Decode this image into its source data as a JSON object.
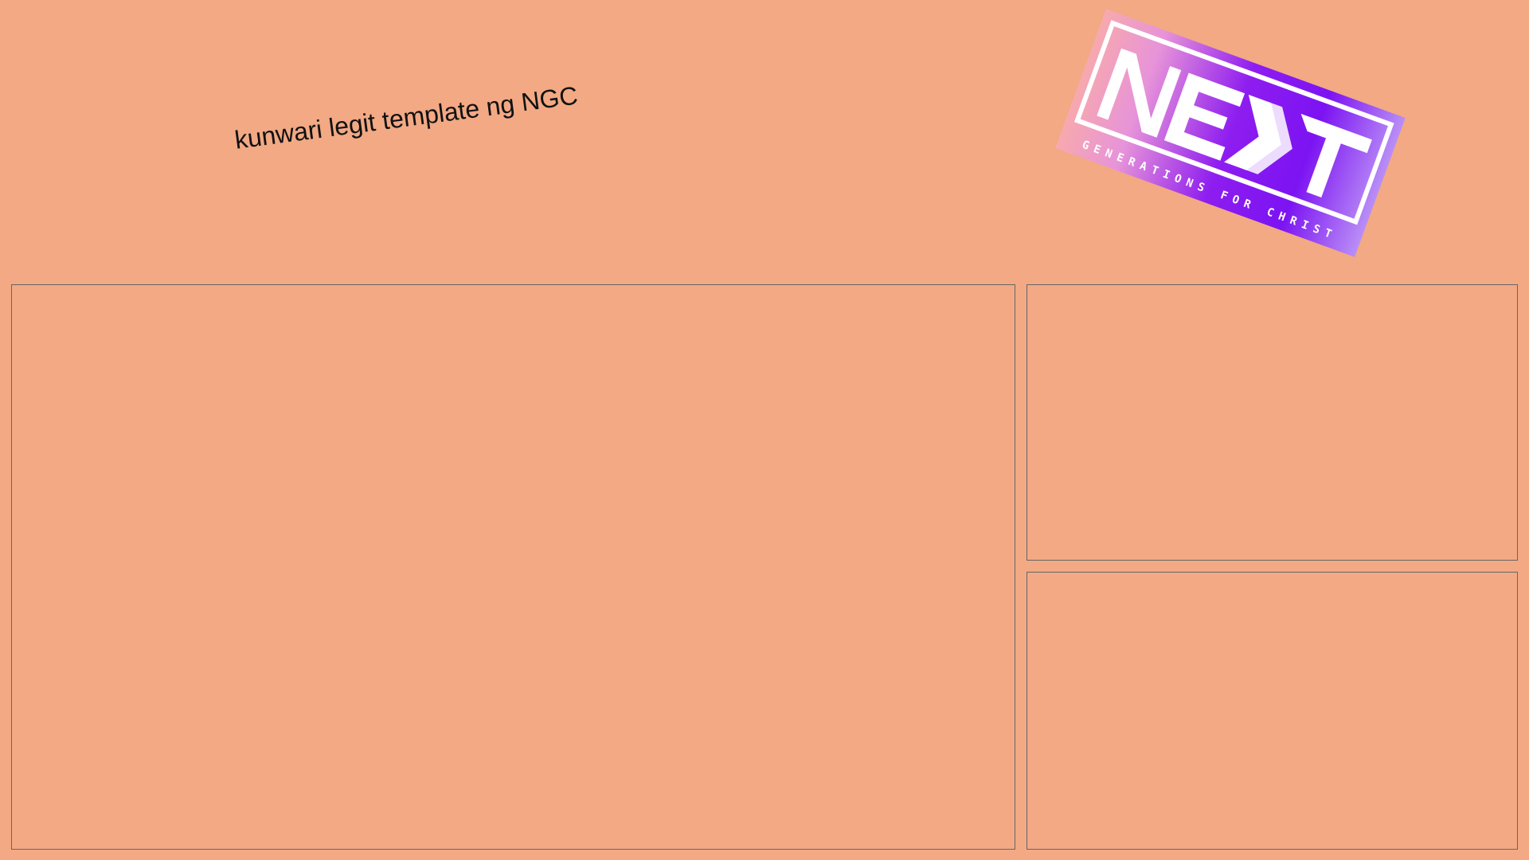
{
  "caption": {
    "text": "kunwari legit template ng NGC"
  },
  "logo": {
    "wordmark": "NEXT",
    "tagline": "GENERATIONS FOR CHRIST"
  },
  "colors": {
    "background": "#f2a984",
    "panel_border": "#666666",
    "logo_gradient": [
      "#f7a9ae",
      "#e793d9",
      "#8e1df0",
      "#7c13f2",
      "#b98ef6"
    ]
  },
  "panels": [
    {
      "id": "main-video-frame"
    },
    {
      "id": "top-right-frame"
    },
    {
      "id": "bottom-right-frame"
    }
  ]
}
